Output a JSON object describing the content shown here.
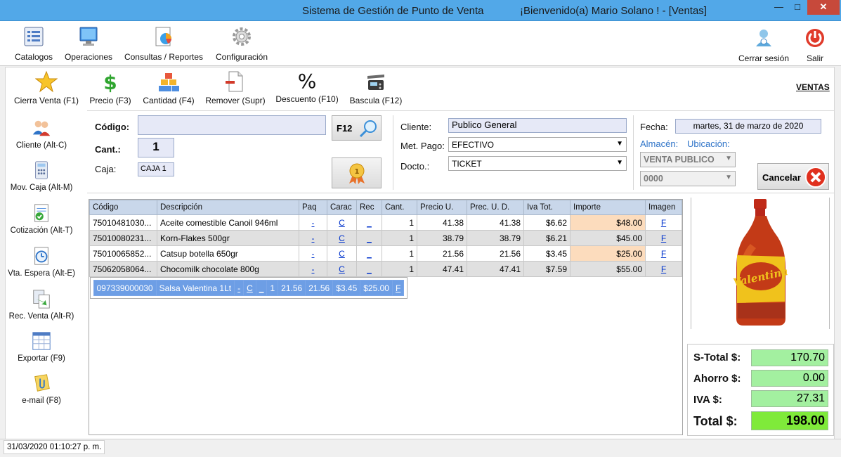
{
  "window": {
    "title": "Sistema de Gestión de Punto de Venta",
    "welcome": "¡Bienvenido(a) Mario Solano ! - [Ventas]",
    "min": "—",
    "max": "□",
    "close": "✕"
  },
  "main_menu": {
    "items": [
      "Catalogos",
      "Operaciones",
      "Consultas / Reportes",
      "Configuración"
    ],
    "logout": "Cerrar sesión",
    "exit": "Salir"
  },
  "toolbar": {
    "items": [
      "Cierra Venta (F1)",
      "Precio (F3)",
      "Cantidad (F4)",
      "Remover (Supr)",
      "Descuento (F10)",
      "Bascula (F12)"
    ],
    "section_link": "VENTAS"
  },
  "sidebar": {
    "items": [
      "Cliente (Alt-C)",
      "Mov. Caja (Alt-M)",
      "Cotización (Alt-T)",
      "Vta. Espera (Alt-E)",
      "Rec. Venta (Alt-R)",
      "Exportar (F9)",
      "e-mail (F8)"
    ]
  },
  "form": {
    "codigo_label": "Código:",
    "codigo_value": "",
    "cant_label": "Cant.:",
    "cant_value": "1",
    "caja_label": "Caja:",
    "caja_value": "CAJA 1",
    "f12_button": "F12",
    "cliente_label": "Cliente:",
    "cliente_value": "Publico General",
    "metpago_label": "Met. Pago:",
    "metpago_value": "EFECTIVO",
    "docto_label": "Docto.:",
    "docto_value": "TICKET",
    "fecha_label": "Fecha:",
    "fecha_value": "martes, 31 de marzo de 2020",
    "almacen_label": "Almacén:",
    "ubicacion_label": "Ubicación:",
    "almacen_value": "VENTA PUBLICO",
    "ubicacion_value": "0000",
    "cancel_button": "Cancelar"
  },
  "grid": {
    "columns": [
      "Código",
      "Descripción",
      "Paq",
      "Carac",
      "Rec",
      "Cant.",
      "Precio U.",
      "Prec. U. D.",
      "Iva Tot.",
      "Importe",
      "Imagen"
    ],
    "rows": [
      [
        "75010481030...",
        "Aceite comestible Canoil 946ml",
        "-",
        "C",
        "_",
        "1",
        "41.38",
        "41.38",
        "$6.62",
        "$48.00",
        "F"
      ],
      [
        "75010080231...",
        "Korn-Flakes 500gr",
        "-",
        "C",
        "_",
        "1",
        "38.79",
        "38.79",
        "$6.21",
        "$45.00",
        "F"
      ],
      [
        "75010065852...",
        "Catsup botella 650gr",
        "-",
        "C",
        "_",
        "1",
        "21.56",
        "21.56",
        "$3.45",
        "$25.00",
        "F"
      ],
      [
        "75062058064...",
        "Chocomilk chocolate 800g",
        "-",
        "C",
        "_",
        "1",
        "47.41",
        "47.41",
        "$7.59",
        "$55.00",
        "F"
      ],
      [
        "097339000030",
        "Salsa Valentina 1Lt",
        "-",
        "C",
        "_",
        "1",
        "21.56",
        "21.56",
        "$3.45",
        "$25.00",
        "F"
      ]
    ]
  },
  "product_image_label": "Valentina",
  "totals": {
    "subtotal_label": "S-Total $:",
    "subtotal": "170.70",
    "ahorro_label": "Ahorro $:",
    "ahorro": "0.00",
    "iva_label": "IVA $:",
    "iva": "27.31",
    "total_label": "Total $:",
    "total": "198.00"
  },
  "status": {
    "datetime": "31/03/2020 01:10:27 p. m."
  }
}
